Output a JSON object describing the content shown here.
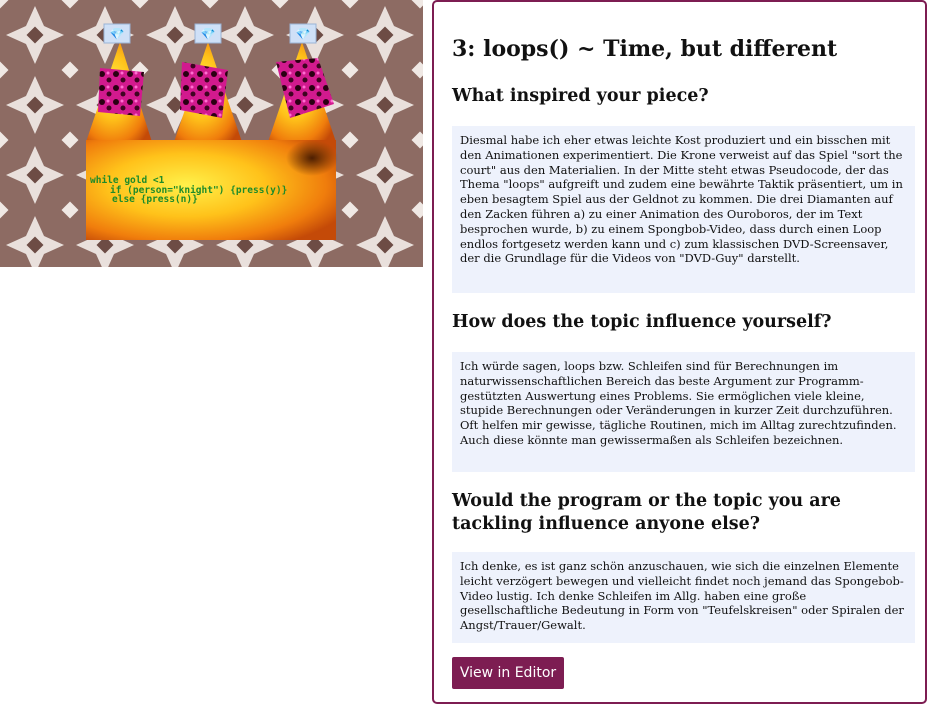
{
  "title": "3: loops() ~ Time, but different",
  "sections": [
    {
      "question": "What inspired your piece?",
      "answer": "Diesmal habe ich eher etwas leichte Kost produziert und ein bisschen mit den Animationen experimentiert. Die Krone verweist auf das Spiel \"sort the court\" aus den Materialien. In der Mitte steht etwas Pseudocode, der das Thema \"loops\" aufgreift und zudem eine bewährte Taktik präsentiert, um in eben besagtem Spiel aus der Geldnot zu kommen. Die drei Diamanten auf den Zacken führen a) zu einer Animation des Ouroboros, der im Text besprochen wurde, b) zu einem Spongbob-Video, dass durch einen Loop endlos fortgesetz werden kann und c) zum klassischen DVD-Screensaver, der die Grundlage für die Videos von \"DVD-Guy\" darstellt."
    },
    {
      "question": "How does the topic influence yourself?",
      "answer": "Ich würde sagen, loops bzw. Schleifen sind für Berechnungen im naturwissenschaftlichen Bereich das beste Argument zur Programm-gestützten Auswertung eines Problems. Sie ermöglichen viele kleine, stupide Berechnungen oder Veränderungen in kurzer Zeit durchzuführen. Oft helfen mir gewisse, tägliche Routinen, mich im Alltag zurechtzufinden. Auch diese könnte man gewissermaßen als Schleifen bezeichnen."
    },
    {
      "question": "Would the program or the topic you are tackling influence anyone else?",
      "answer": "Ich denke, es ist ganz schön anzuschauen, wie sich die einzelnen Elemente leicht verzögert bewegen und vielleicht findet noch jemand das Spongebob-Video lustig. Ich denke Schleifen im Allg. haben eine große gesellschaftliche Bedeutung in Form von \"Teufelskreisen\" oder Spiralen der Angst/Trauer/Gewalt."
    }
  ],
  "editor_button": "View in Editor",
  "artwork": {
    "code_lines": [
      "while gold <1",
      "if (person=\"knight\") {press(y)}",
      "else {press(n)}"
    ],
    "diamond_icon": "💎"
  },
  "colors": {
    "accent": "#7d1d52",
    "answer_bg": "#eef2fc",
    "code_green": "#1e8b2a"
  }
}
